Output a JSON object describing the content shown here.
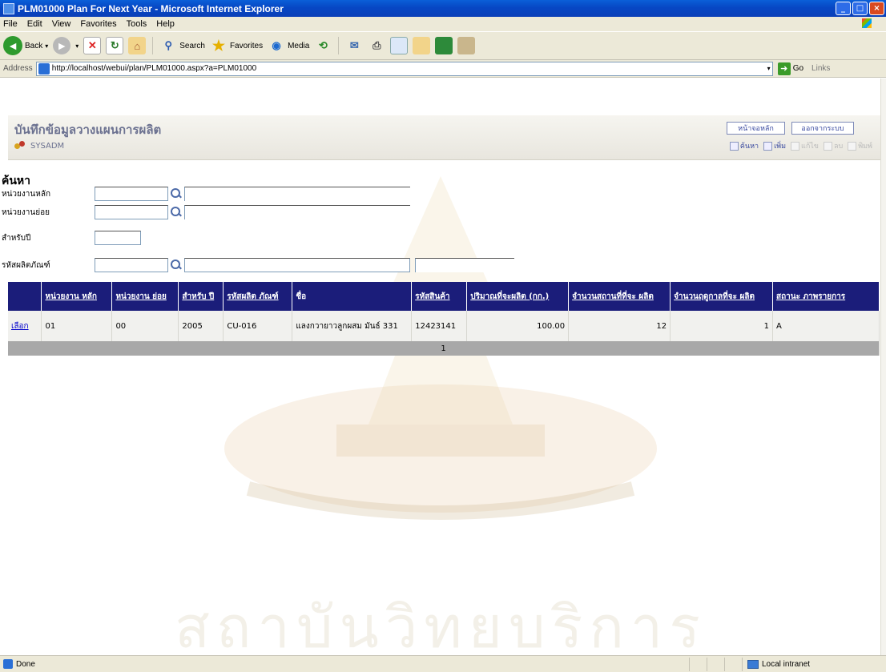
{
  "window": {
    "title": "PLM01000 Plan For Next Year - Microsoft Internet Explorer"
  },
  "menu": [
    "File",
    "Edit",
    "View",
    "Favorites",
    "Tools",
    "Help"
  ],
  "toolbar": {
    "back": "Back",
    "search": "Search",
    "favorites": "Favorites",
    "media": "Media"
  },
  "address": {
    "label": "Address",
    "url": "http://localhost/webui/plan/PLM01000.aspx?a=PLM01000",
    "go": "Go",
    "links": "Links"
  },
  "header": {
    "title": "บันทึกข้อมูลวางแผนการผลิต",
    "user": "SYSADM",
    "home_button": "หน้าจอหลัก",
    "logout_button": "ออกจากระบบ",
    "tools": [
      "ค้นหา",
      "เพิ่ม",
      "แก้ไข",
      "ลบ",
      "พิมพ์"
    ]
  },
  "search": {
    "title": "ค้นหา",
    "labels": {
      "main_unit": "หน่วยงานหลัก",
      "sub_unit": "หน่วยงานย่อย",
      "year": "สำหรับปี",
      "product_code": "รหัสผลิตภัณฑ์"
    }
  },
  "table": {
    "headers": [
      "หน่วยงาน หลัก",
      "หน่วยงาน ย่อย",
      "สำหรับ ปี",
      "รหัสผลิต ภัณฑ์",
      "ชื่อ",
      "รหัสสินค้า",
      "ปริมาณที่จะผลิต (กก.)",
      "จำนวนสถานที่ที่จะ ผลิต",
      "จำนวนฤดูกาลที่จะ ผลิต",
      "สถานะ ภาพรายการ"
    ],
    "rows": [
      {
        "select": "เลือก",
        "cells": [
          "01",
          "00",
          "2005",
          "CU-016",
          "แลงกวายาวลูกผสม มันธ์ 331",
          "12423141",
          "100.00",
          "12",
          "1",
          "A"
        ]
      }
    ],
    "pager": "1"
  },
  "watermark": "สถาบันวิทยบริการ",
  "status": {
    "left": "Done",
    "zone": "Local intranet"
  }
}
